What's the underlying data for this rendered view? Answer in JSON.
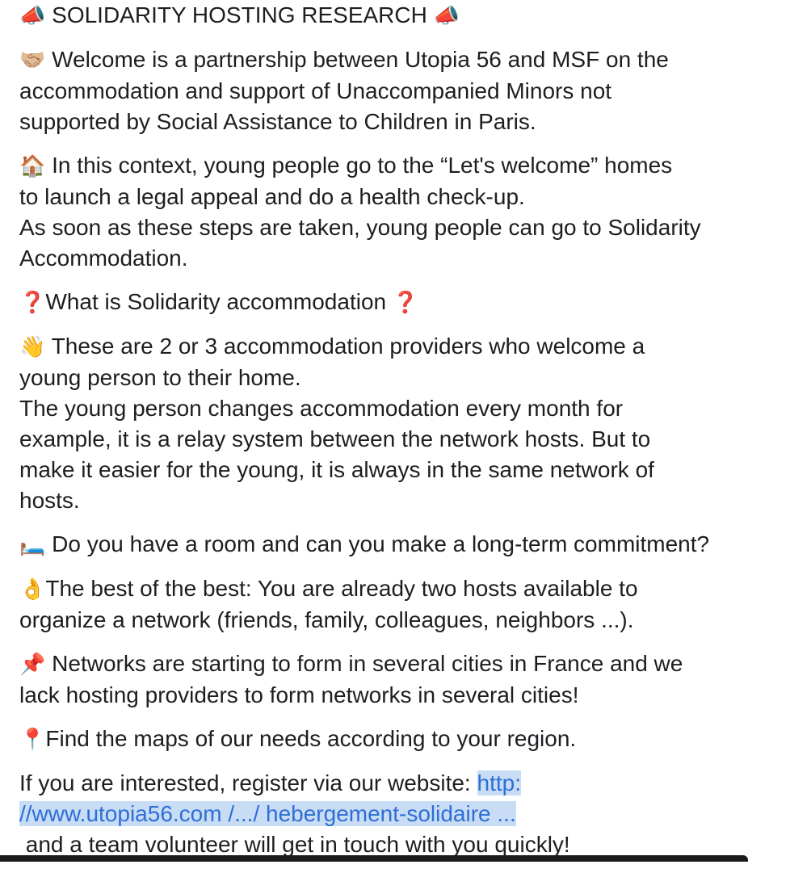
{
  "post": {
    "title": "SOLIDARITY HOSTING RESEARCH",
    "title_icon": "📣",
    "p1": {
      "icon": "🤝🏼",
      "lines": [
        "Welcome is a partnership between Utopia 56 and MSF on the",
        "accommodation and support of Unaccompanied Minors not",
        "supported by Social Assistance to Children in Paris."
      ]
    },
    "p2": {
      "icon": "🏠",
      "lines": [
        "In this context, young people go to the “Let's welcome” homes",
        "to launch a legal appeal and do a health check-up.",
        "As soon as these steps are taken, young people can go to Solidarity",
        "Accommodation."
      ]
    },
    "p3": {
      "icon": "❓",
      "text": "What is Solidarity accommodation"
    },
    "p4": {
      "icon": "👋",
      "lines": [
        "These are 2 or 3 accommodation providers who welcome a",
        "young person to their home.",
        "The young person changes accommodation every month for",
        "example, it is a relay system between the network hosts. But to",
        "make it easier for the young, it is always in the same network of",
        "hosts."
      ]
    },
    "p5": {
      "icon": "🛏️",
      "text": "Do you have a room and can you make a long-term commitment?"
    },
    "p6": {
      "icon": "👌",
      "lines": [
        "The best of the best: You are already two hosts available to",
        "organize a network (friends, family, colleagues, neighbors ...)."
      ]
    },
    "p7": {
      "icon": "📌",
      "lines": [
        "Networks are starting to form in several cities in France and we",
        "lack hosting providers to form networks in several cities!"
      ]
    },
    "p8": {
      "icon": "📍",
      "text": "Find the maps of our needs according to your region."
    },
    "p9": {
      "prefix": "If you are interested, register via our website: ",
      "link_part1": "http:",
      "link_part2": "//www.utopia56.com /.../ hebergement-solidaire ...",
      "suffix": " and a team volunteer will get in touch with you quickly!"
    }
  },
  "colors": {
    "text": "#1c1e21",
    "link": "#2d6fd6",
    "link_highlight": "#c9dcf5"
  }
}
